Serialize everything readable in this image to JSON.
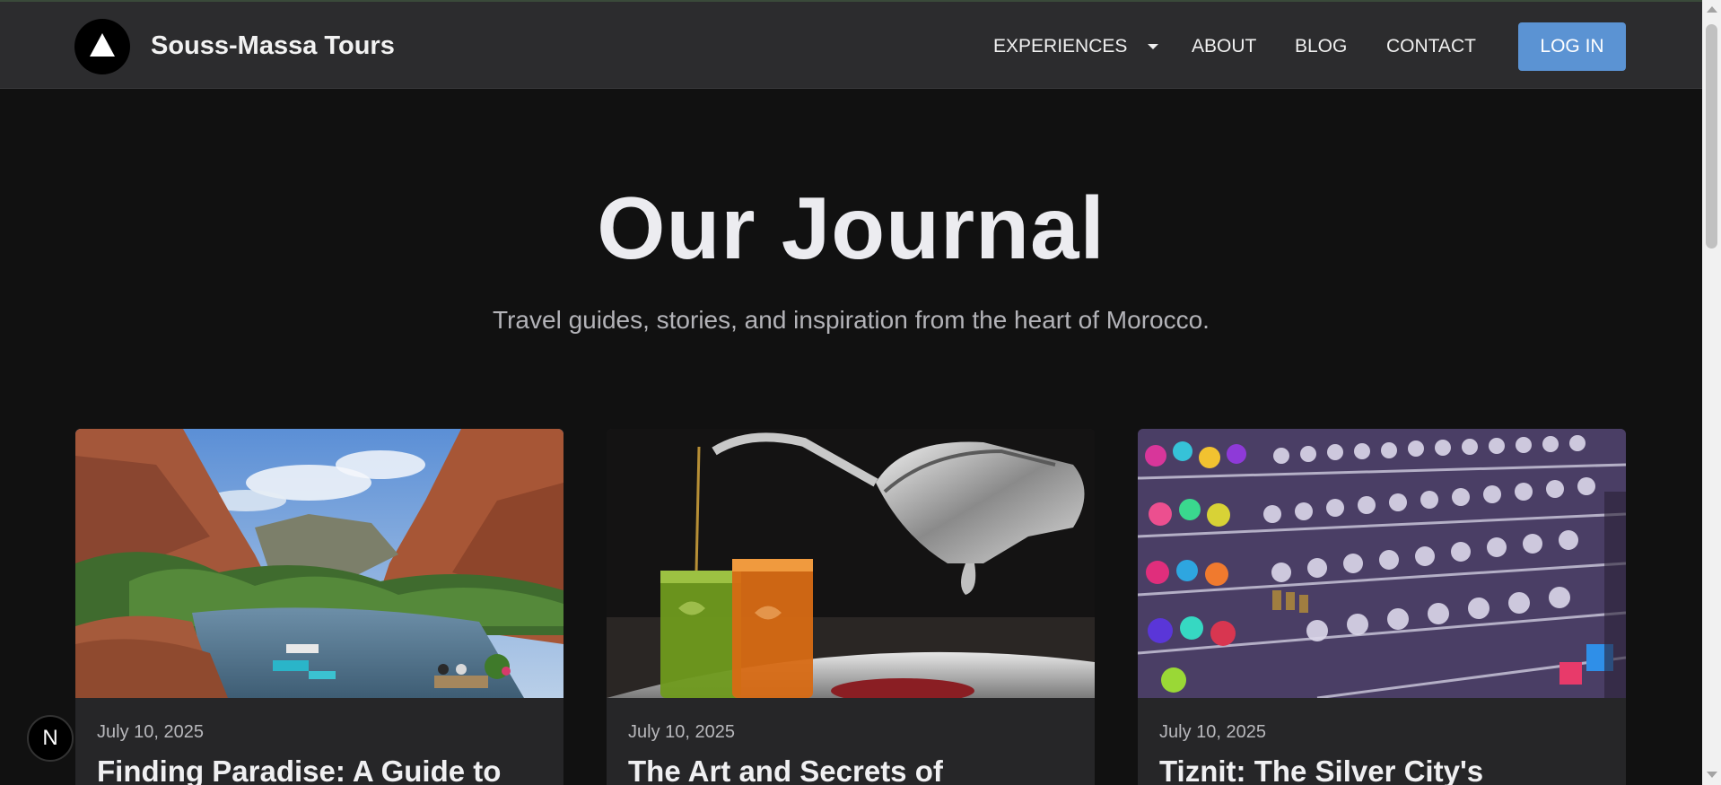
{
  "header": {
    "brand": "Souss-Massa Tours",
    "nav": {
      "experiences": "EXPERIENCES",
      "about": "ABOUT",
      "blog": "BLOG",
      "contact": "CONTACT"
    },
    "login_label": "LOG IN"
  },
  "hero": {
    "title": "Our Journal",
    "subtitle": "Travel guides, stories, and inspiration from the heart of Morocco."
  },
  "posts": [
    {
      "date": "July 10, 2025",
      "title": "Finding Paradise: A Guide to"
    },
    {
      "date": "July 10, 2025",
      "title": "The Art and Secrets of"
    },
    {
      "date": "July 10, 2025",
      "title": "Tiznit: The Silver City's"
    }
  ],
  "dev_badge": "N",
  "colors": {
    "accent": "#5b93d3",
    "background": "#111111",
    "navbar": "#2c2c2e",
    "card": "#262628"
  }
}
